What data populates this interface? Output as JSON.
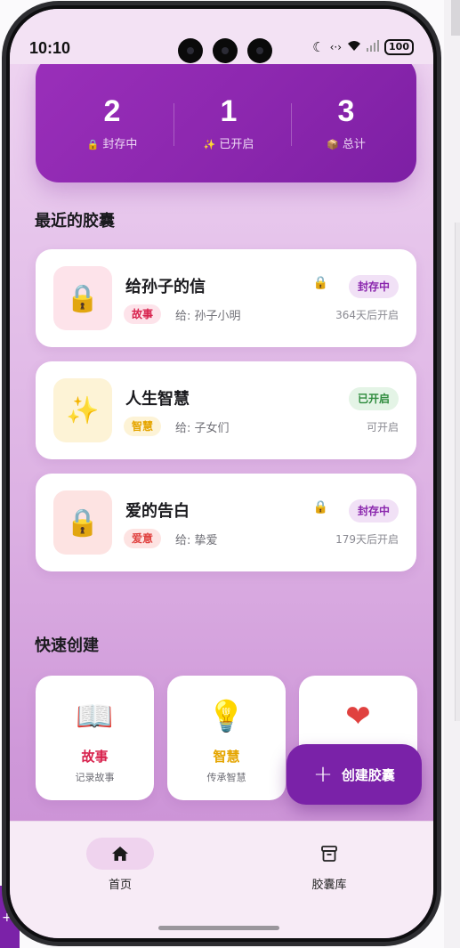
{
  "status_bar": {
    "time": "10:10",
    "battery": "100"
  },
  "stats": [
    {
      "value": "2",
      "label": "封存中",
      "icon": "lock-icon"
    },
    {
      "value": "1",
      "label": "已开启",
      "icon": "sparkle-icon"
    },
    {
      "value": "3",
      "label": "总计",
      "icon": "box-icon"
    }
  ],
  "recent_title": "最近的胶囊",
  "capsules": [
    {
      "title": "给孙子的信",
      "tag": "故事",
      "to": "给: 孙子小明",
      "status": "封存中",
      "time": "364天后开启",
      "locked": true
    },
    {
      "title": "人生智慧",
      "tag": "智慧",
      "to": "给: 子女们",
      "status": "已开启",
      "time": "可开启",
      "locked": false
    },
    {
      "title": "爱的告白",
      "tag": "爱意",
      "to": "给: 挚爱",
      "status": "封存中",
      "time": "179天后开启",
      "locked": true
    }
  ],
  "quick_title": "快速创建",
  "quick_create": [
    {
      "title": "故事",
      "subtitle": "记录故事",
      "icon": "book-icon"
    },
    {
      "title": "智慧",
      "subtitle": "传承智慧",
      "icon": "lightbulb-icon"
    },
    {
      "title": "",
      "subtitle": "",
      "icon": "heart-icon"
    }
  ],
  "fab": {
    "label": "创建胶囊"
  },
  "nav": [
    {
      "label": "首页",
      "icon": "home-icon",
      "active": true
    },
    {
      "label": "胶囊库",
      "icon": "archive-icon",
      "active": false
    }
  ],
  "colors": {
    "accent": "#7a22a8",
    "story": "#d8224d",
    "wisdom": "#e5a500",
    "love": "#e0413f",
    "opened": "#2e8b3d"
  }
}
